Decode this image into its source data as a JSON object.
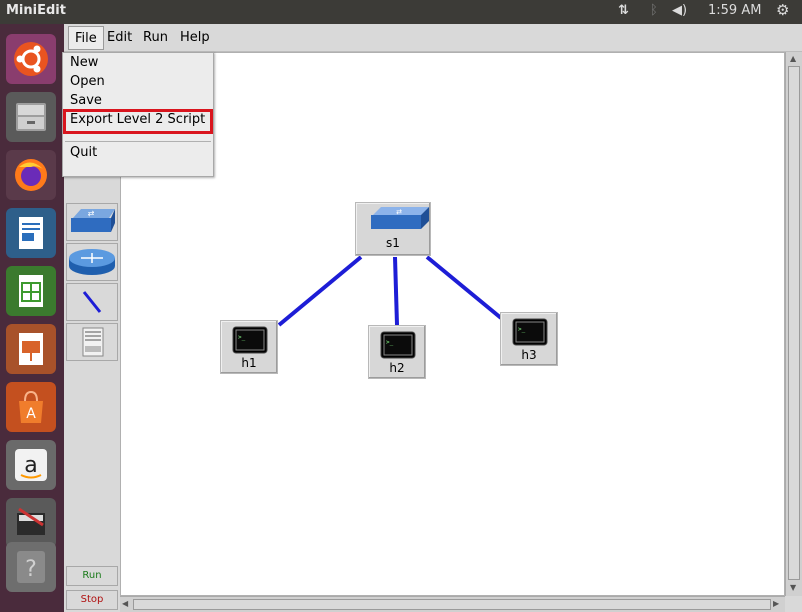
{
  "top_panel": {
    "app_title": "MiniEdit",
    "clock": "1:59 AM",
    "icons": [
      "network-icon",
      "bluetooth-icon",
      "volume-icon",
      "settings-gear-icon"
    ]
  },
  "launcher": {
    "items": [
      "ubuntu-icon",
      "files-icon",
      "firefox-icon",
      "writer-icon",
      "calc-icon",
      "impress-icon",
      "software-center-icon",
      "amazon-icon",
      "system-settings-icon",
      "help-icon"
    ]
  },
  "menubar": {
    "file": "File",
    "edit": "Edit",
    "run": "Run",
    "help": "Help"
  },
  "file_menu": {
    "items": [
      "New",
      "Open",
      "Save",
      "Export Level 2 Script",
      "Quit"
    ],
    "highlighted": "Export Level 2 Script"
  },
  "toolbar": {
    "run_label": "Run",
    "stop_label": "Stop",
    "colors": {
      "run": "#1a7a1a",
      "stop": "#b01010"
    }
  },
  "topology": {
    "nodes": [
      {
        "id": "s1",
        "type": "switch"
      },
      {
        "id": "h1",
        "type": "host"
      },
      {
        "id": "h2",
        "type": "host"
      },
      {
        "id": "h3",
        "type": "host"
      }
    ],
    "links": [
      [
        "s1",
        "h1"
      ],
      [
        "s1",
        "h2"
      ],
      [
        "s1",
        "h3"
      ]
    ],
    "link_color": "#1d1dd6"
  }
}
